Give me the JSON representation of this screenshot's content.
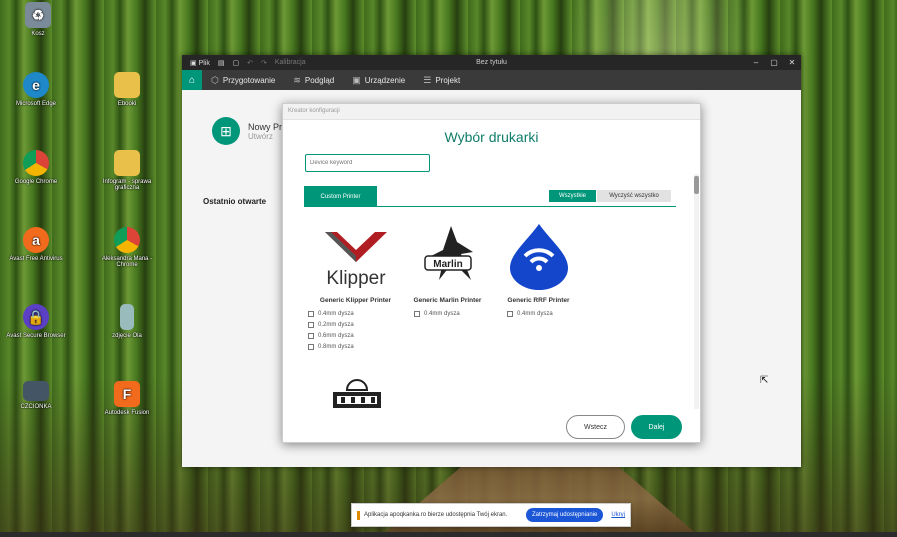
{
  "desktop": {
    "icons": [
      {
        "label": "Kosz",
        "icon": "recycle-bin-icon",
        "color": "#7a8a99"
      },
      {
        "label": "Microsoft Edge",
        "icon": "edge-icon",
        "color": "#1e88c9"
      },
      {
        "label": "Ebooki",
        "icon": "folder-icon",
        "color": "#e8c04a"
      },
      {
        "label": "Google Chrome",
        "icon": "chrome-icon",
        "color": "#db4437"
      },
      {
        "label": "Infogram - sprawa graficzna",
        "icon": "folder-image-icon",
        "color": "#e8c04a"
      },
      {
        "label": "Avast Free Antivirus",
        "icon": "avast-icon",
        "color": "#f26b1d"
      },
      {
        "label": "Aleksandra Mana - Chrome",
        "icon": "chrome-profile-icon",
        "color": "#db4437"
      },
      {
        "label": "Avast Secure Browser",
        "icon": "avast-browser-icon",
        "color": "#5b3fc4"
      },
      {
        "label": "zdjęcie Ola",
        "icon": "image-file-icon",
        "color": "#9bb"
      },
      {
        "label": "CZCIONKA",
        "icon": "font-folder-icon",
        "color": "#456"
      },
      {
        "label": "Autodesk Fusion",
        "icon": "fusion-icon",
        "color": "#f26b1d"
      }
    ]
  },
  "window": {
    "titlebar": {
      "file_label": "Plik",
      "title": "Bez tytułu",
      "gray_item": "Kalibracja"
    },
    "menu": [
      {
        "label": "Przygotowanie",
        "icon": "cube-icon"
      },
      {
        "label": "Podgląd",
        "icon": "layers-icon"
      },
      {
        "label": "Urządzenie",
        "icon": "device-icon"
      },
      {
        "label": "Projekt",
        "icon": "list-icon"
      }
    ],
    "new_project": {
      "line1": "Nowy Pr",
      "line2": "Utwórz"
    },
    "recent_label": "Ostatnio otwarte"
  },
  "dialog": {
    "header": "Kreator konfiguracji",
    "title": "Wybór drukarki",
    "search_placeholder": "Device keyword",
    "tab_custom": "Custom Printer",
    "select_all": "Wszystkie",
    "clear_all": "Wyczyść wszystko",
    "printers": [
      {
        "name": "Generic Klipper Printer",
        "logo": "klipper-logo",
        "options": [
          "0.4mm dysza",
          "0.2mm dysza",
          "0.6mm dysza",
          "0.8mm dysza"
        ]
      },
      {
        "name": "Generic Marlin Printer",
        "logo": "marlin-logo",
        "options": [
          "0.4mm dysza"
        ]
      },
      {
        "name": "Generic RRF Printer",
        "logo": "rrf-logo",
        "options": [
          "0.4mm dysza"
        ]
      }
    ],
    "back_label": "Wstecz",
    "next_label": "Dalej"
  },
  "notification": {
    "message": "Aplikacja apoqkanka.ro bierze udostępnia Twój ekran.",
    "stop_label": "Zatrzymaj udostępnianie",
    "hide_label": "Ukryj"
  }
}
